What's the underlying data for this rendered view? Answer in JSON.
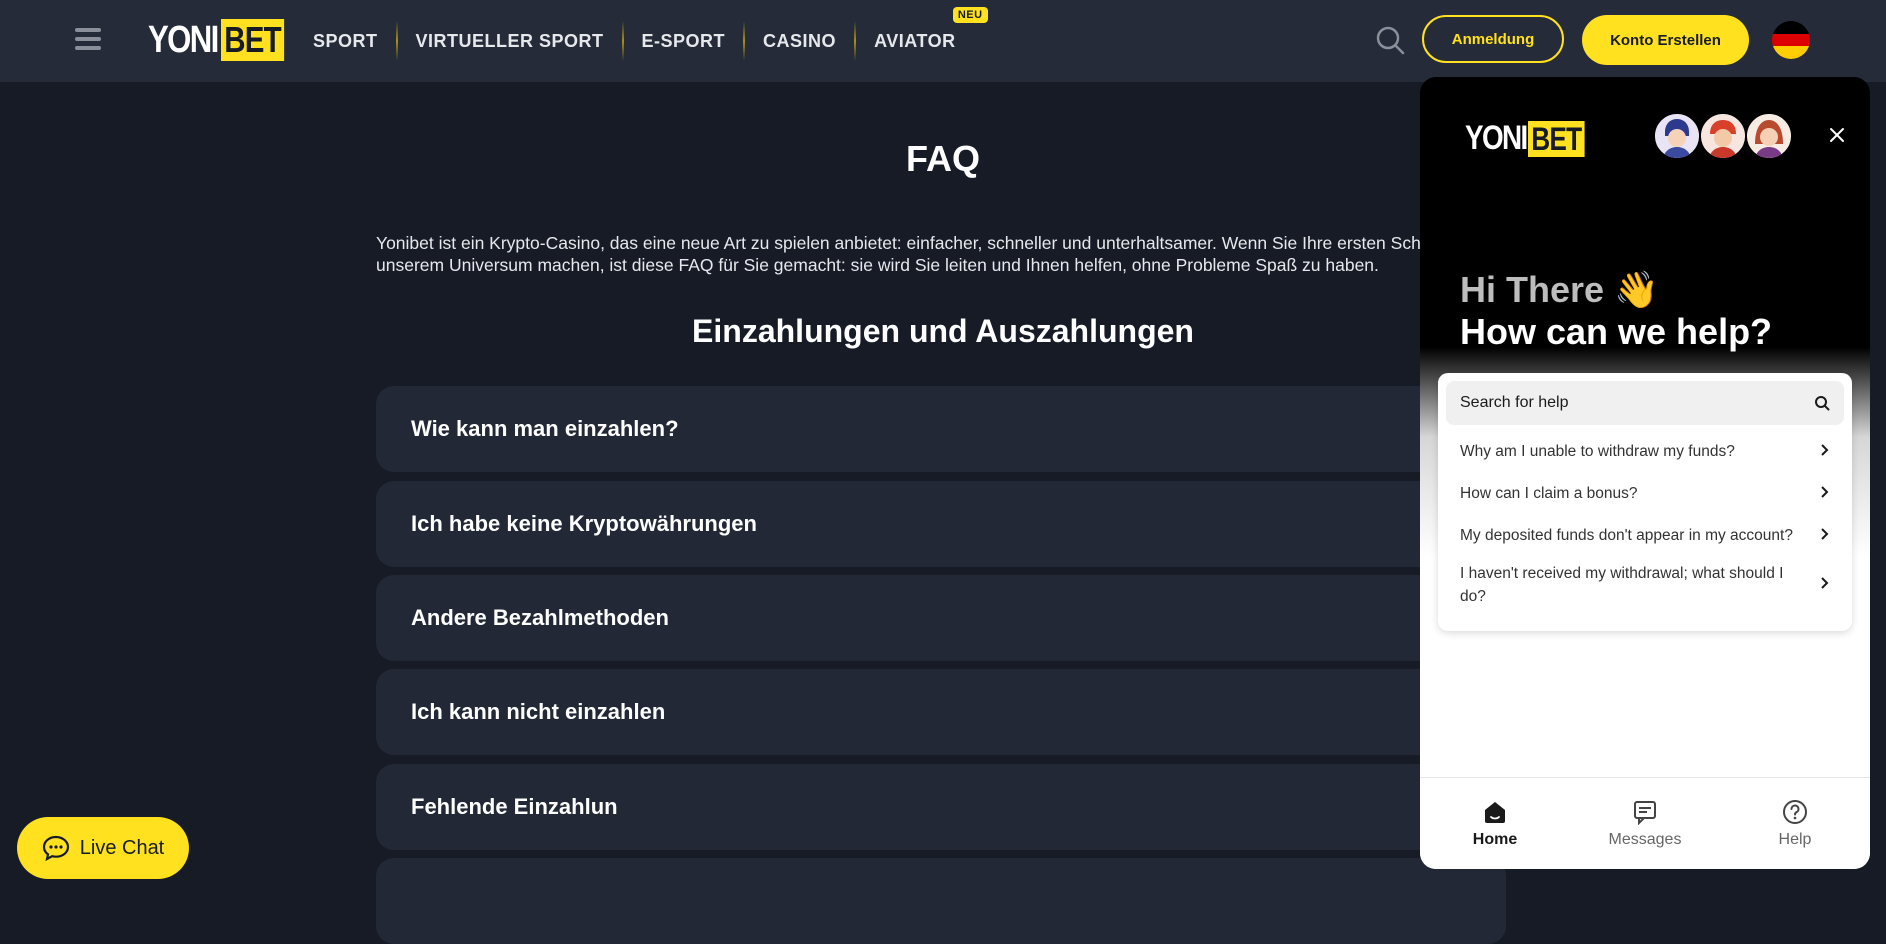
{
  "header": {
    "logo_left": "YONI",
    "logo_right": "BET",
    "nav": [
      {
        "label": "SPORT"
      },
      {
        "label": "VIRTUELLER SPORT"
      },
      {
        "label": "E-SPORT"
      },
      {
        "label": "CASINO"
      },
      {
        "label": "AVIATOR",
        "badge": "NEU"
      }
    ],
    "login_label": "Anmeldung",
    "register_label": "Konto Erstellen"
  },
  "main": {
    "title": "FAQ",
    "intro_line1": "Yonibet ist ein Krypto-Casino, das eine neue Art zu spielen anbietet: einfacher, schneller und unterhaltsamer. Wenn Sie Ihre ersten Schritte in",
    "intro_line2": "unserem Universum machen, ist diese FAQ für Sie gemacht: sie wird Sie leiten und Ihnen helfen, ohne Probleme Spaß zu haben.",
    "section_title": "Einzahlungen und Auszahlungen",
    "faq_items": [
      "Wie kann man einzahlen?",
      "Ich habe keine Kryptowährungen",
      "Andere Bezahlmethoden",
      "Ich kann nicht einzahlen",
      "Fehlende Einzahlun"
    ]
  },
  "live_chat_label": "Live Chat",
  "widget": {
    "logo_left": "YONI",
    "logo_right": "BET",
    "greeting_line1": "Hi There 👋",
    "greeting_line2": "How can we help?",
    "search_placeholder": "Search for help",
    "help_items": [
      "Why am I unable to withdraw my funds?",
      "How can I claim a bonus?",
      "My deposited funds don't appear in my account?",
      "I haven't received my withdrawal; what should I do?"
    ],
    "tabs": [
      {
        "label": "Home",
        "icon": "home-icon"
      },
      {
        "label": "Messages",
        "icon": "messages-icon"
      },
      {
        "label": "Help",
        "icon": "help-icon"
      }
    ]
  },
  "colors": {
    "accent": "#ffe11f",
    "header_bg": "#252b38",
    "page_bg": "#161b26",
    "card_bg": "#222835"
  }
}
